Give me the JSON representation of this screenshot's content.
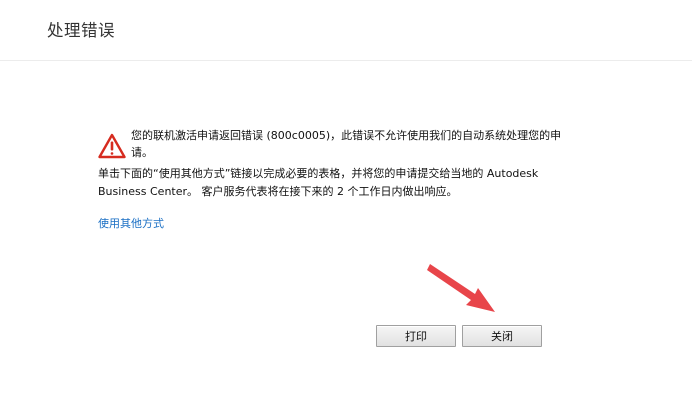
{
  "dialog": {
    "title": "处理错误",
    "message_line1": "您的联机激活申请返回错误 (800c0005)，此错误不允许使用我们的自动系统处理您的申请。",
    "message_line2": "单击下面的“使用其他方式”链接以完成必要的表格，并将您的申请提交给当地的 Autodesk Business Center。 客户服务代表将在接下来的 2 个工作日内做出响应。",
    "alternate_link": "使用其他方式",
    "print_button": "打印",
    "close_button": "关闭"
  },
  "colors": {
    "link": "#1a6fc4",
    "warning": "#d62b1f",
    "annotation_arrow": "#e8454a"
  },
  "icons": {
    "warning": "warning-triangle-icon",
    "annotation": "red-arrow-annotation"
  }
}
